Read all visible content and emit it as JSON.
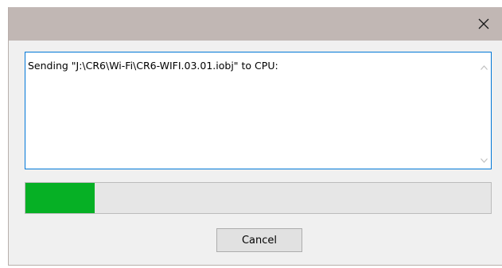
{
  "window": {
    "titlebar_color": "#c1b7b4",
    "close_icon": "close-icon"
  },
  "log": {
    "text": "Sending \"J:\\CR6\\Wi-Fi\\CR6-WIFI.03.01.iobj\" to CPU:",
    "border_color": "#0078d7"
  },
  "progress": {
    "value_percent": 14.8,
    "fill_color": "#06b025"
  },
  "buttons": {
    "cancel_label": "Cancel"
  }
}
